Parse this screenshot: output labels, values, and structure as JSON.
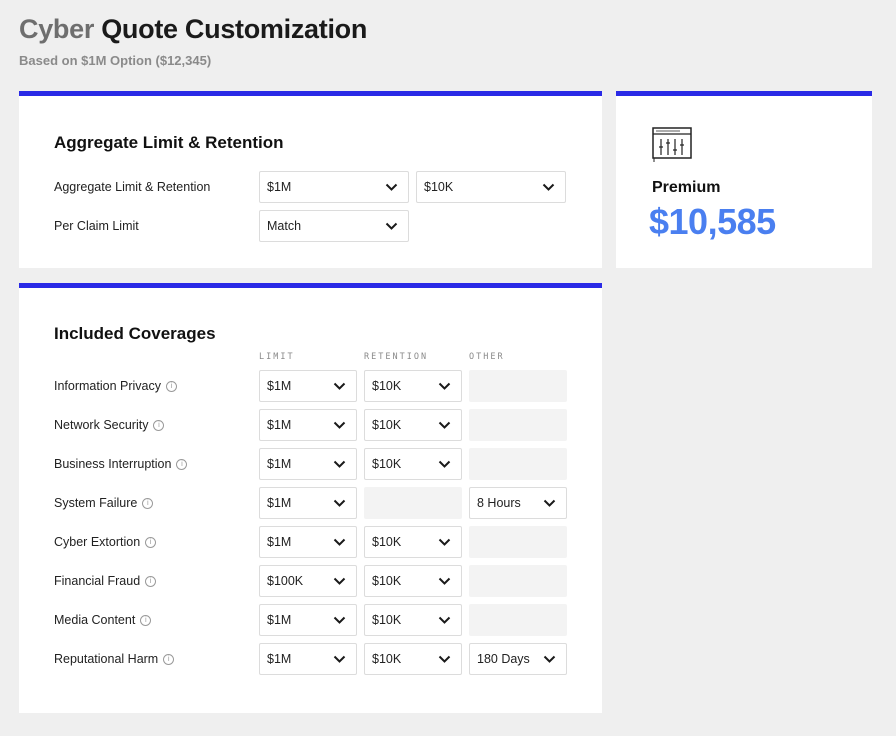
{
  "header": {
    "title_part1": "Cyber",
    "title_part2": "Quote Customization",
    "subtitle": "Based on $1M Option ($12,345)"
  },
  "aggregate": {
    "heading": "Aggregate Limit & Retention",
    "rows": [
      {
        "label": "Aggregate Limit & Retention",
        "limit": "$1M",
        "retention": "$10K"
      },
      {
        "label": "Per Claim Limit",
        "limit": "Match"
      }
    ]
  },
  "premium": {
    "label": "Premium",
    "value": "$10,585",
    "icon": "settings-sliders-icon"
  },
  "coverages": {
    "heading": "Included Coverages",
    "columns": {
      "limit": "LIMIT",
      "retention": "RETENTION",
      "other": "OTHER"
    },
    "rows": [
      {
        "label": "Information Privacy",
        "limit": "$1M",
        "retention": "$10K",
        "other": ""
      },
      {
        "label": "Network Security",
        "limit": "$1M",
        "retention": "$10K",
        "other": ""
      },
      {
        "label": "Business Interruption",
        "limit": "$1M",
        "retention": "$10K",
        "other": ""
      },
      {
        "label": "System Failure",
        "limit": "$1M",
        "retention": "",
        "other": "8 Hours"
      },
      {
        "label": "Cyber Extortion",
        "limit": "$1M",
        "retention": "$10K",
        "other": ""
      },
      {
        "label": "Financial Fraud",
        "limit": "$100K",
        "retention": "$10K",
        "other": ""
      },
      {
        "label": "Media Content",
        "limit": "$1M",
        "retention": "$10K",
        "other": ""
      },
      {
        "label": "Reputational Harm",
        "limit": "$1M",
        "retention": "$10K",
        "other": "180 Days"
      }
    ]
  },
  "colors": {
    "accent": "#2a2ae6",
    "premium": "#4a7ff0"
  }
}
